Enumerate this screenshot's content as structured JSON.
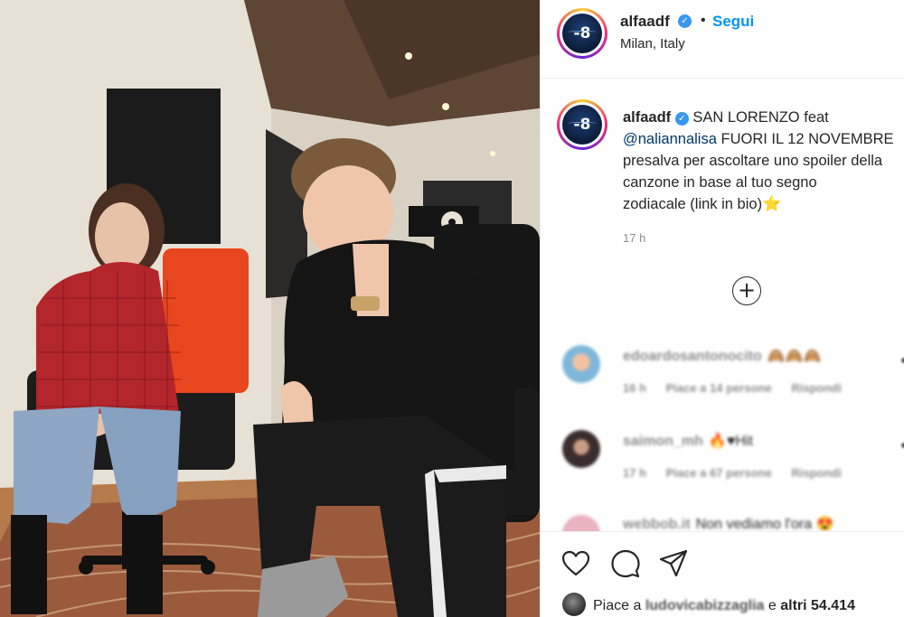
{
  "post": {
    "username": "alfaadf",
    "follow_label": "Segui",
    "dot": "•",
    "location": "Milan, Italy",
    "avatar_text": "-8"
  },
  "caption": {
    "username": "alfaadf",
    "line1_text": "SAN LORENZO feat",
    "mention": "@naliannalisa",
    "line2_text": "FUORI IL 12 NOVEMBRE",
    "line3": "presalva per ascoltare uno spoiler della",
    "line4": "canzone in base al tuo segno",
    "line5": "zodiacale (link in bio)",
    "star": "⭐",
    "time": "17 h"
  },
  "comments": [
    {
      "username": "edoardosantonocito",
      "text": "🙈🙈🙈",
      "time": "16 h",
      "likes": "Piace a 14 persone",
      "reply": "Rispondi",
      "avatar_color": "#7fb6d9"
    },
    {
      "username": "saimon_mh",
      "text": "🔥♥Hit",
      "time": "17 h",
      "likes": "Piace a 67 persone",
      "reply": "Rispondi",
      "avatar_color": "#4a3a3a"
    },
    {
      "username": "webbob.it",
      "text": "Non vediamo l'ora 😍",
      "time": "",
      "likes": "",
      "reply": "",
      "avatar_color": "#e9b3c0"
    }
  ],
  "actions": {
    "likes_prefix": "Piace a",
    "likes_user": "ludovicabizzaglia",
    "likes_suffix": "e",
    "likes_count": "altri 54.414"
  },
  "colors": {
    "link_blue": "#0095f6",
    "verified_blue": "#3897f0",
    "mention_blue": "#00376b",
    "muted_gray": "#8e8e8e"
  },
  "icons": [
    "verified-icon",
    "plus-circle-icon",
    "heart-icon",
    "comment-icon",
    "share-icon"
  ]
}
